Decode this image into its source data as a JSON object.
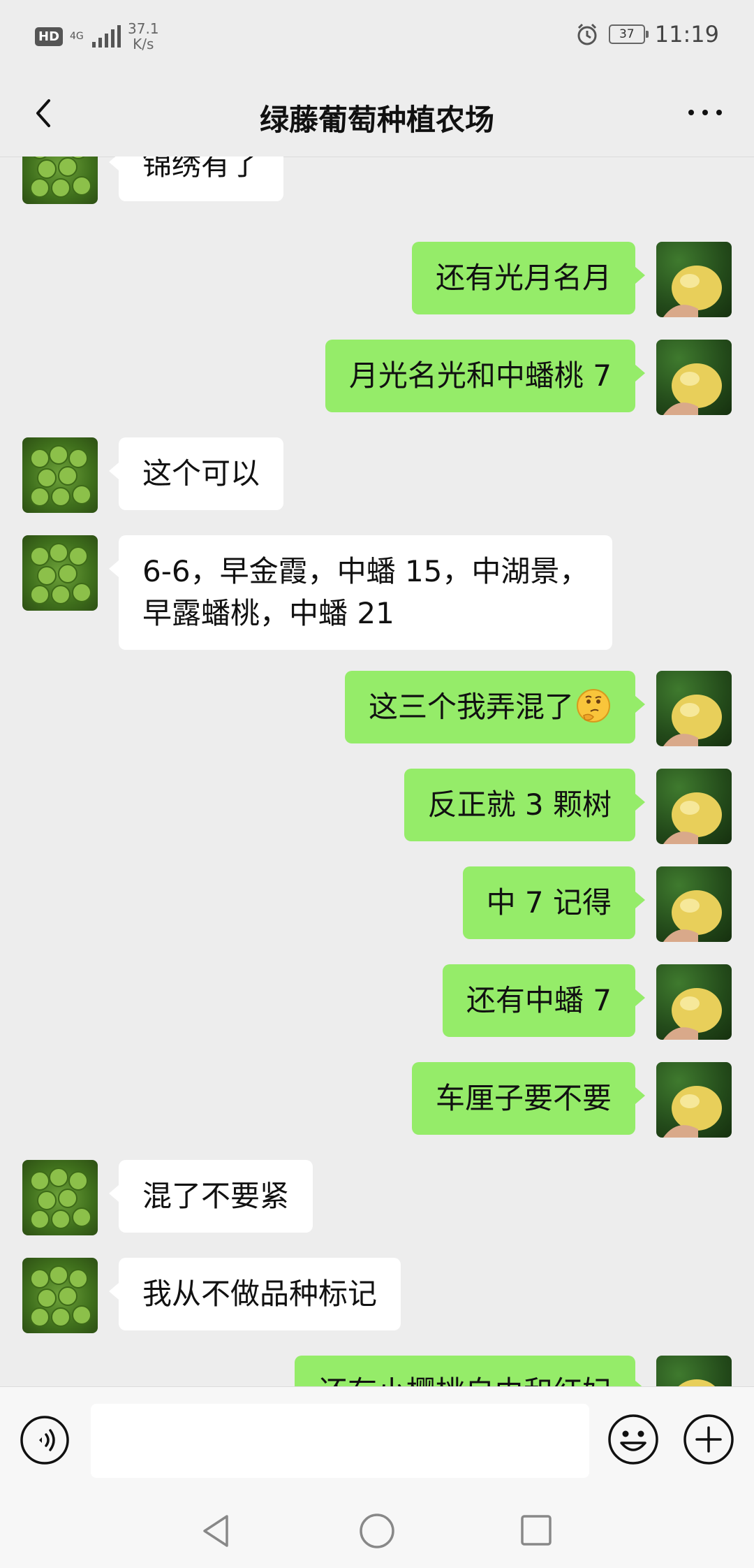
{
  "status_bar": {
    "hd": "HD",
    "network": "4G",
    "speed_value": "37.1",
    "speed_unit": "K/s",
    "battery": "37",
    "time": "11:19"
  },
  "header": {
    "title": "绿藤葡萄种植农场"
  },
  "messages": [
    {
      "side": "left",
      "text": "锦绣有了"
    },
    {
      "side": "right",
      "text": "还有光月名月"
    },
    {
      "side": "right",
      "text": "月光名光和中蟠桃 7"
    },
    {
      "side": "left",
      "text": "这个可以"
    },
    {
      "side": "left",
      "line1": "6-6，早金霞，中蟠 15，中湖景，",
      "line2": "早露蟠桃，中蟠 21"
    },
    {
      "side": "right",
      "text": "这三个我弄混了",
      "emoji": "thinking-face"
    },
    {
      "side": "right",
      "text": "反正就 3 颗树"
    },
    {
      "side": "right",
      "text": "中 7 记得"
    },
    {
      "side": "right",
      "text": "还有中蟠 7"
    },
    {
      "side": "right",
      "text": "车厘子要不要"
    },
    {
      "side": "left",
      "text": "混了不要紧"
    },
    {
      "side": "left",
      "text": "我从不做品种标记"
    },
    {
      "side": "right",
      "text": "还有小樱桃自由和红妃"
    }
  ],
  "input": {
    "value": "",
    "voice_icon": "voice-icon",
    "emoji_icon": "emoji-icon",
    "plus_icon": "plus-icon"
  },
  "colors": {
    "background": "#ededed",
    "sent_bubble": "#95ec69",
    "received_bubble": "#ffffff"
  }
}
